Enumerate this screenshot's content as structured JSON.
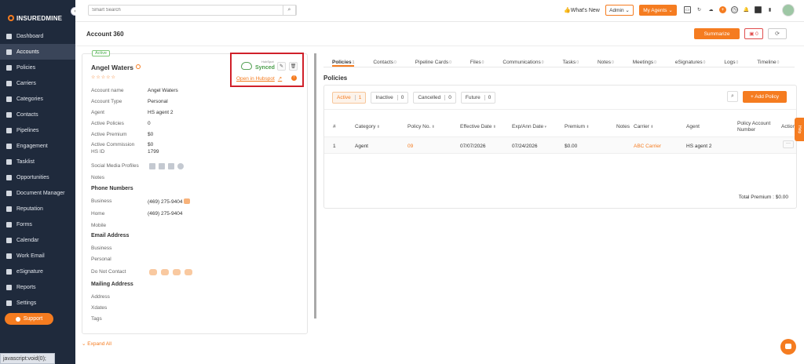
{
  "app": {
    "brand": "INSUREDMINE"
  },
  "sidebar": {
    "items": [
      {
        "label": "Dashboard",
        "active": false
      },
      {
        "label": "Accounts",
        "active": true
      },
      {
        "label": "Policies",
        "active": false
      },
      {
        "label": "Carriers",
        "active": false
      },
      {
        "label": "Categories",
        "active": false
      },
      {
        "label": "Contacts",
        "active": false
      },
      {
        "label": "Pipelines",
        "active": false
      },
      {
        "label": "Engagement",
        "active": false
      },
      {
        "label": "Tasklist",
        "active": false
      },
      {
        "label": "Opportunities",
        "active": false
      },
      {
        "label": "Document Manager",
        "active": false
      },
      {
        "label": "Reputation",
        "active": false
      },
      {
        "label": "Forms",
        "active": false
      },
      {
        "label": "Calendar",
        "active": false
      },
      {
        "label": "Work Email",
        "active": false
      },
      {
        "label": "eSignature",
        "active": false
      },
      {
        "label": "Reports",
        "active": false
      },
      {
        "label": "Settings",
        "active": false
      }
    ],
    "support_label": "Support"
  },
  "topbar": {
    "search_placeholder": "Smart Search",
    "whats_new": "What's New",
    "admin": "Admin",
    "my_agents": "My Agents"
  },
  "header": {
    "title": "Account 360",
    "summarize": "Summarize",
    "inbox_count": "0"
  },
  "account": {
    "status": "Active",
    "name": "Angel Waters",
    "stars": "☆☆☆☆☆",
    "fields": [
      {
        "label": "Account name",
        "value": "Angel Waters"
      },
      {
        "label": "Account Type",
        "value": "Personal"
      },
      {
        "label": "Agent",
        "value": "HS agent 2"
      },
      {
        "label": "Active Policies",
        "value": "0"
      },
      {
        "label": "Active Premium",
        "value": "$0"
      },
      {
        "label": "Active Commission",
        "value": "$0"
      },
      {
        "label": "HS ID",
        "value": "1799"
      }
    ],
    "social_label": "Social Media Profiles",
    "notes_label": "Notes",
    "phone_section": "Phone Numbers",
    "phones": [
      {
        "label": "Business",
        "value": "(469) 275-9404"
      },
      {
        "label": "Home",
        "value": "(469) 275-9404"
      },
      {
        "label": "Mobile",
        "value": ""
      }
    ],
    "email_section": "Email Address",
    "emails": [
      {
        "label": "Business"
      },
      {
        "label": "Personal"
      }
    ],
    "dnc_label": "Do Not Contact",
    "mailing_section": "Mailing Address",
    "mailing": [
      {
        "label": "Address"
      },
      {
        "label": "Xdates"
      },
      {
        "label": "Tags"
      }
    ],
    "expand_all": "Expand All"
  },
  "sync": {
    "provider_small": "HubSpot",
    "status": "Synced",
    "open_link": "Open in Hubspot"
  },
  "tabs": [
    {
      "label": "Policies",
      "count": "1",
      "active": true
    },
    {
      "label": "Contacts",
      "count": "0"
    },
    {
      "label": "Pipeline Cards",
      "count": "0"
    },
    {
      "label": "Files",
      "count": "0"
    },
    {
      "label": "Communications",
      "count": "0"
    },
    {
      "label": "Tasks",
      "count": "0"
    },
    {
      "label": "Notes",
      "count": "0"
    },
    {
      "label": "Meetings",
      "count": "0"
    },
    {
      "label": "eSignatures",
      "count": "0"
    },
    {
      "label": "Logs",
      "count": "0"
    },
    {
      "label": "Timeline",
      "count": "0"
    }
  ],
  "policies": {
    "title": "Policies",
    "filters": [
      {
        "label": "Active",
        "count": "1"
      },
      {
        "label": "Inactive",
        "count": "0"
      },
      {
        "label": "Cancelled",
        "count": "0"
      },
      {
        "label": "Future",
        "count": "0"
      }
    ],
    "add_policy": "+ Add Policy",
    "columns": [
      "#",
      "Category",
      "Policy No.",
      "Effective Date",
      "Exp/Ann Date",
      "Premium",
      "Notes",
      "Carrier",
      "Agent",
      "Policy Account Number",
      "Action"
    ],
    "rows": [
      {
        "num": "1",
        "category": "Agent",
        "policy_no": "09",
        "effective": "07/07/2026",
        "exp": "07/24/2026",
        "premium": "$0.00",
        "notes": "",
        "carrier": "ABC Carrier",
        "agent": "HS agent 2",
        "account_number": ""
      }
    ],
    "total": "Total Premium : $0.00"
  },
  "statusbar": {
    "text": "javascript:void(0);"
  },
  "help": "Help",
  "colors": {
    "accent": "#f57c20",
    "sidebar": "#1f2a3c",
    "highlight_box": "#d0202a"
  }
}
